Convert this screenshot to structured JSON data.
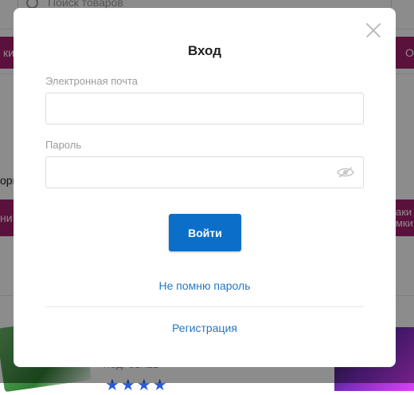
{
  "background": {
    "search_placeholder": "Поиск товаров",
    "left_tab_label": "ки",
    "right_tab_label": "О",
    "left_text": "орк",
    "left_band_label": "ни",
    "right_band_label": "аки\nмки",
    "product_small_text": "ПОДРОБНЕЕ"
  },
  "modal": {
    "title": "Вход",
    "email_label": "Электронная почта",
    "email_value": "",
    "password_label": "Пароль",
    "password_value": "",
    "submit_label": "Войти",
    "forgot_label": "Не помню пароль",
    "register_label": "Регистрация"
  },
  "colors": {
    "accent": "#0b6fc9",
    "link": "#2378c4",
    "brand_pink": "#a51f6c"
  }
}
